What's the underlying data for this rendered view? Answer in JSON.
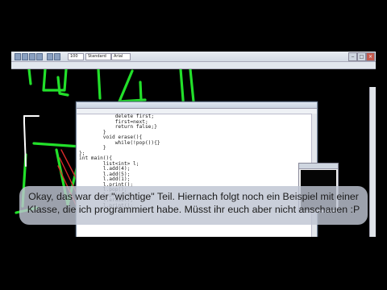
{
  "colors": {
    "drawing_stroke": "#22e02a",
    "drawing_red": "#d82a2a",
    "letterbox": "#000000"
  },
  "paint": {
    "toolbar_value": "100",
    "toolbar_label": "Standard",
    "font_value": "Arial",
    "icons": [
      "new-file-icon",
      "open-folder-icon",
      "save-icon",
      "print-icon",
      "undo-icon",
      "redo-icon"
    ]
  },
  "editor": {
    "code_lines": [
      "            delete first;",
      "            first=next;",
      "            return false;}",
      "        }",
      "        void erase(){",
      "            while(!pop()){}",
      "        }",
      "};",
      "int main(){",
      "        list<int> l;",
      "        l.add(4);",
      "        l.add(5);",
      "        l.add(1);",
      "        l.print();",
      "        l.pop();",
      "        l.print();",
      "        l.erase();",
      "        l.print();",
      "}"
    ]
  },
  "subtitle": {
    "line1": "Okay, das war der \"wichtige\" Teil. Hiernach folgt noch ein Beispiel mit einer",
    "line2": "Klasse, die ich programmiert habe. Müsst ihr euch aber nicht anschauen :P"
  }
}
